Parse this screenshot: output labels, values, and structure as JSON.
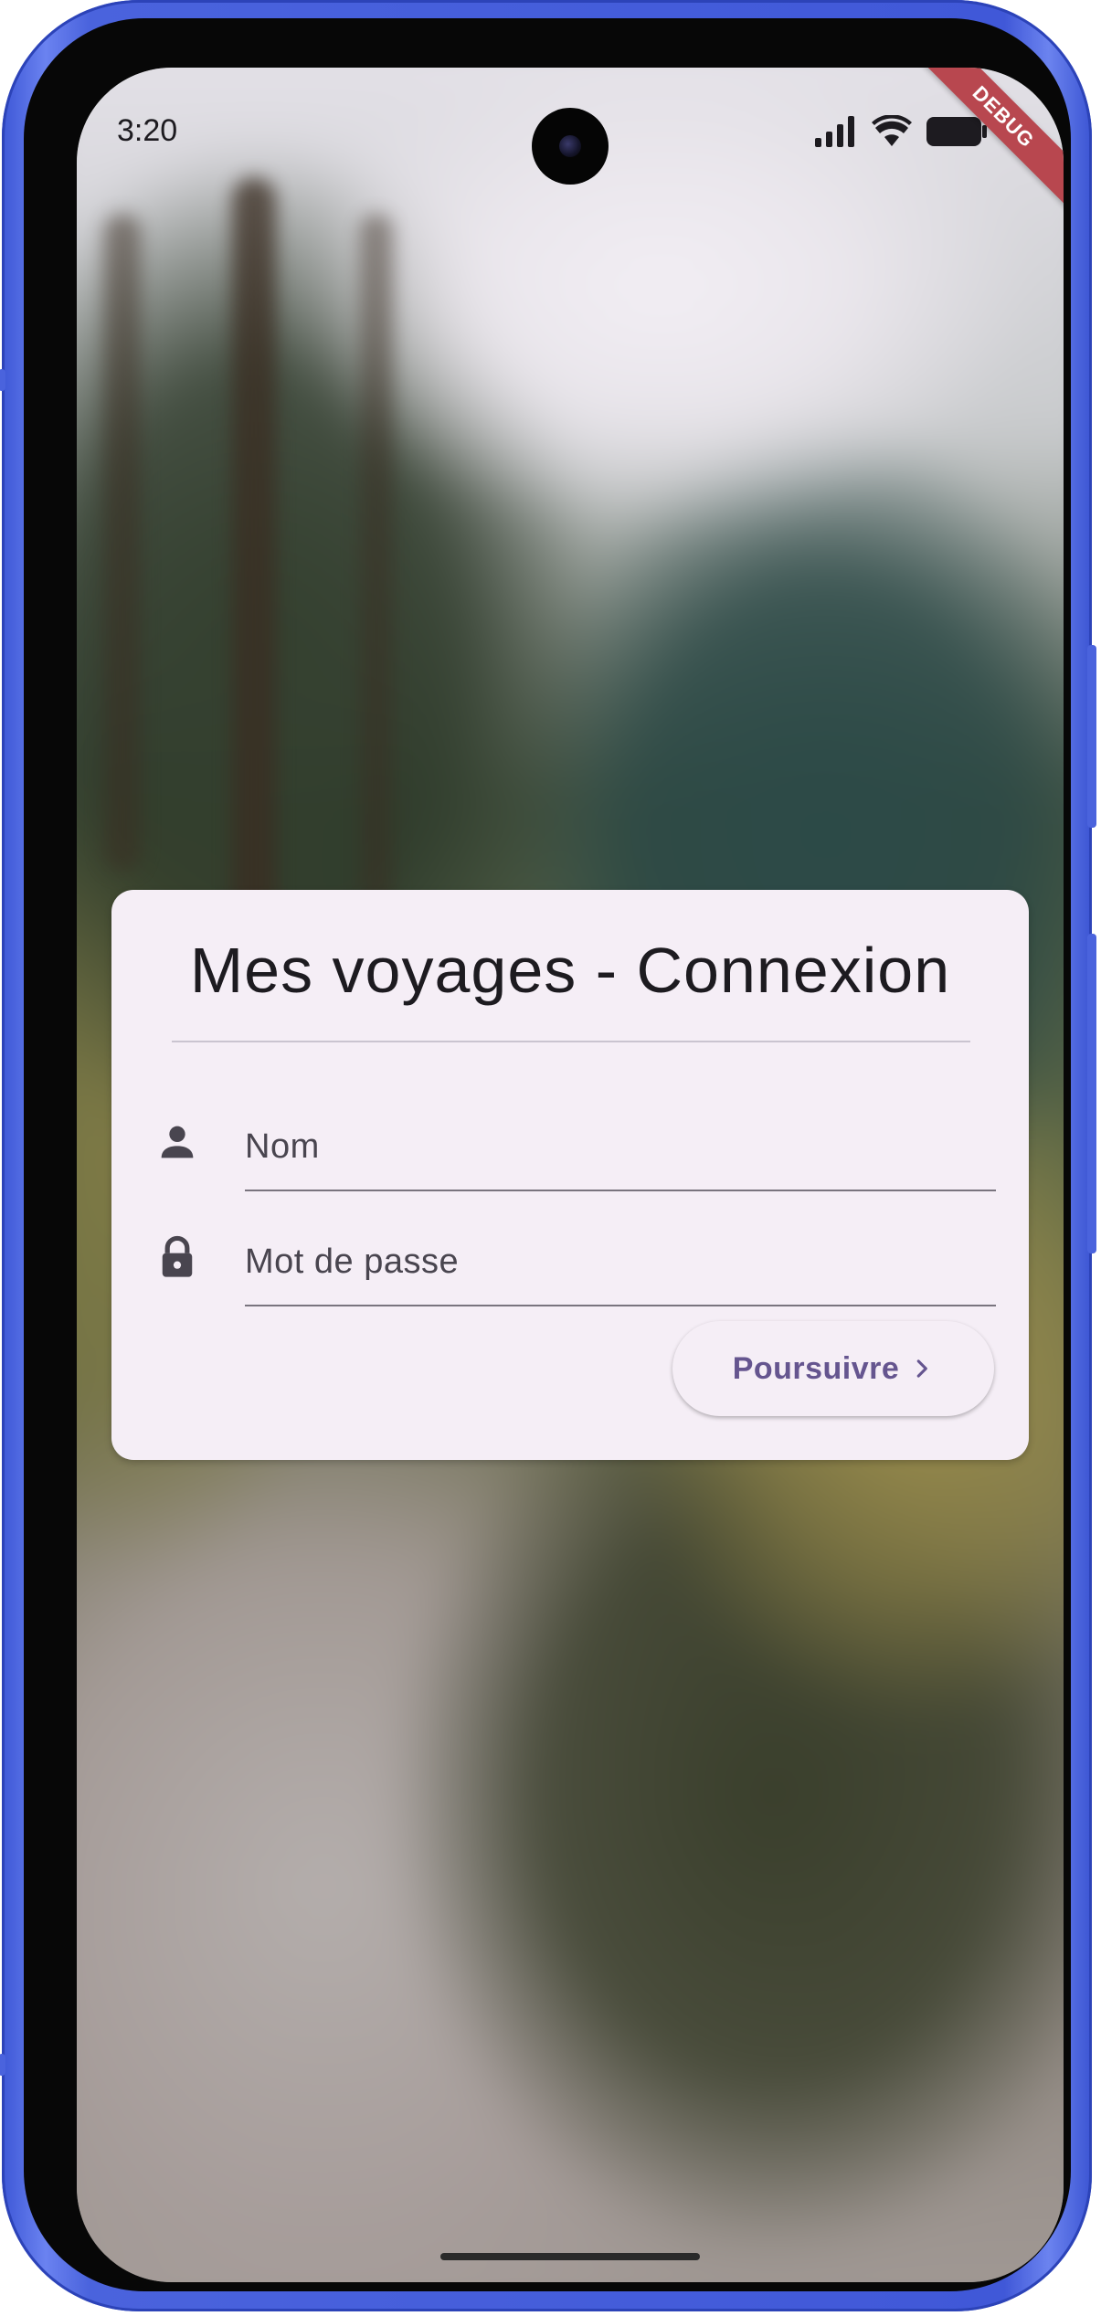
{
  "status_bar": {
    "time": "3:20",
    "signal_icon": "cellular-signal-icon",
    "wifi_icon": "wifi-icon",
    "battery_icon": "battery-icon"
  },
  "debug_banner": "DEBUG",
  "login_card": {
    "title": "Mes voyages - Connexion",
    "name_field": {
      "icon": "person-icon",
      "placeholder": "Nom",
      "value": ""
    },
    "password_field": {
      "icon": "lock-icon",
      "placeholder": "Mot de passe",
      "value": ""
    },
    "continue_button": {
      "label": "Poursuivre",
      "icon": "chevron-right-icon"
    }
  },
  "colors": {
    "frame": "#4a63dd",
    "card_background": "#f5eef6",
    "accent": "#65558f",
    "debug_ribbon": "#b8474f",
    "text_primary": "#1d1b20",
    "text_secondary": "#49454f"
  }
}
